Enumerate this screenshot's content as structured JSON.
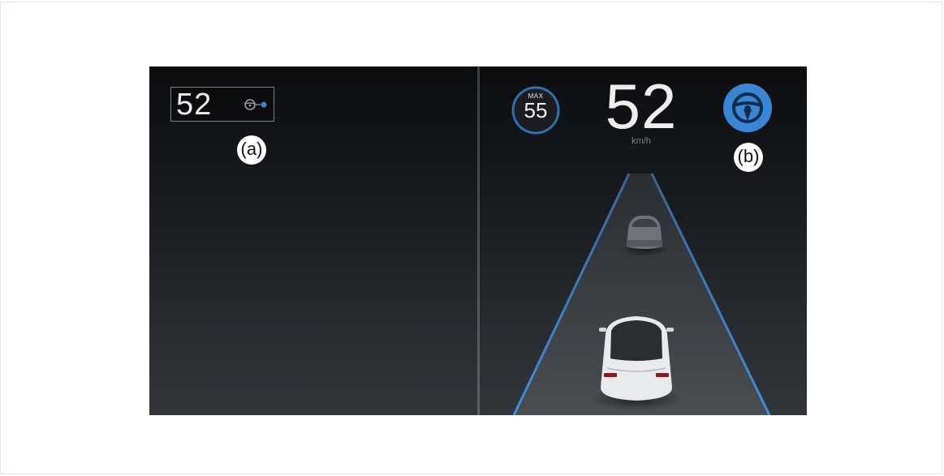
{
  "left_panel": {
    "speed": "52",
    "autosteer_icon": "steering-wheel-with-blue-dot-icon",
    "callout": "(a)"
  },
  "right_panel": {
    "speed_limit_label": "MAX",
    "speed_limit_value": "55",
    "speed": "52",
    "unit": "km/h",
    "autosteer_icon": "steering-wheel-icon",
    "callout": "(b)"
  },
  "colors": {
    "accent_blue": "#3a86d6",
    "lane_line_blue": "#3d8fe0",
    "background_dark": "#16181b",
    "text_light": "#ececec"
  }
}
